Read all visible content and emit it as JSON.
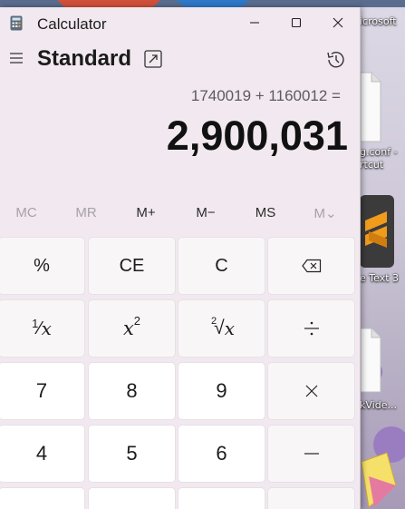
{
  "window": {
    "title": "Calculator",
    "mode": "Standard"
  },
  "display": {
    "expression": "1740019 + 1160012 =",
    "result": "2,900,031"
  },
  "memory": [
    "MC",
    "MR",
    "M+",
    "M−",
    "MS",
    "M⌄"
  ],
  "keys": {
    "percent": "%",
    "ce": "CE",
    "c": "C",
    "reciprocal_one": "1",
    "reciprocal_x": "x",
    "square_x": "x",
    "square_exp": "2",
    "sqrt_index": "2",
    "sqrt_x": "x",
    "n7": "7",
    "n8": "8",
    "n9": "9",
    "n4": "4",
    "n5": "5",
    "n6": "6"
  },
  "desktop": {
    "labels": [
      "icrosoft",
      "g.conf -",
      "rtcut",
      "e Text 3",
      "kVide..."
    ]
  },
  "colors": {
    "window_bg": "#f1e9ef",
    "sublime_orange": "#f19b1d"
  }
}
